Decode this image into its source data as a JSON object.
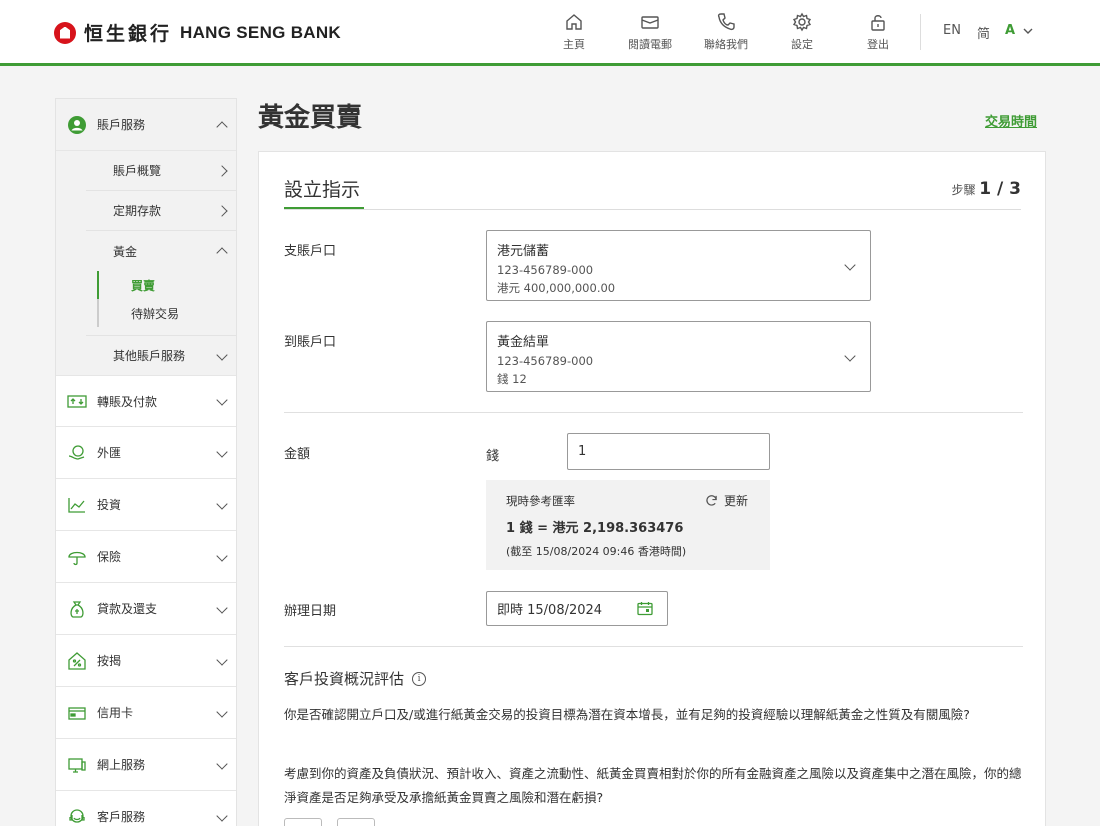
{
  "header": {
    "logo_cn": "恒生銀行",
    "logo_en": "HANG SENG BANK",
    "nav": [
      {
        "label": "主頁",
        "icon": "home-icon"
      },
      {
        "label": "閱讀電郵",
        "icon": "mail-icon"
      },
      {
        "label": "聯絡我們",
        "icon": "phone-icon"
      },
      {
        "label": "設定",
        "icon": "gear-icon"
      },
      {
        "label": "登出",
        "icon": "logout-lock-icon"
      }
    ],
    "lang_en": "EN",
    "lang_sc": "简",
    "font_size": "A"
  },
  "sidebar": {
    "account": {
      "label": "賬戶服務",
      "icon": "user-circle-icon"
    },
    "sub": [
      {
        "label": "賬戶概覽"
      },
      {
        "label": "定期存款"
      },
      {
        "label": "黃金"
      }
    ],
    "gold_sub": [
      {
        "label": "買賣"
      },
      {
        "label": "待辦交易"
      }
    ],
    "other_account": "其他賬戶服務",
    "items": [
      {
        "label": "轉賬及付款",
        "icon": "transfer-icon"
      },
      {
        "label": "外匯",
        "icon": "fx-icon"
      },
      {
        "label": "投資",
        "icon": "chart-line-icon"
      },
      {
        "label": "保險",
        "icon": "umbrella-icon"
      },
      {
        "label": "貸款及還支",
        "icon": "money-bag-icon"
      },
      {
        "label": "按揭",
        "icon": "house-percent-icon"
      },
      {
        "label": "信用卡",
        "icon": "credit-card-icon"
      },
      {
        "label": "網上服務",
        "icon": "computer-icon"
      },
      {
        "label": "客戶服務",
        "icon": "customer-service-icon"
      }
    ]
  },
  "page": {
    "title": "黃金買賣",
    "trade_hours": "交易時間"
  },
  "form": {
    "section_title": "設立指示",
    "step_prefix": "步驟",
    "step_value": "1 / 3",
    "from_label": "支賬戶口",
    "from_account": {
      "name": "港元儲蓄",
      "number": "123-456789-000",
      "balance": "港元 400,000,000.00"
    },
    "to_label": "到賬戶口",
    "to_account": {
      "name": "黃金結單",
      "number": "123-456789-000",
      "balance": "錢 12"
    },
    "amount_label": "金額",
    "amount_unit": "錢",
    "amount_value": "1",
    "rate": {
      "title": "現時參考匯率",
      "refresh": "更新",
      "prefix": "1 錢 = 港元 ",
      "value": "2,198.363476",
      "note": "(截至 15/08/2024 09:46 香港時間)"
    },
    "date_label": "辦理日期",
    "date_value": "即時 15/08/2024",
    "assess_title": "客戶投資概況評估",
    "q1": "你是否確認開立戶口及/或進行紙黃金交易的投資目標為潛在資本增長，並有足夠的投資經驗以理解紙黃金之性質及有關風險?",
    "q2": "考慮到你的資產及負債狀況、預計收入、資產之流動性、紙黃金買賣相對於你的所有金融資產之風險以及資產集中之潛在風險，你的總淨資產是否足夠承受及承擔紙黃金買賣之風險和潛在虧損?"
  },
  "colors": {
    "brand_green": "#3f9c35",
    "brand_red": "#d7131b"
  }
}
